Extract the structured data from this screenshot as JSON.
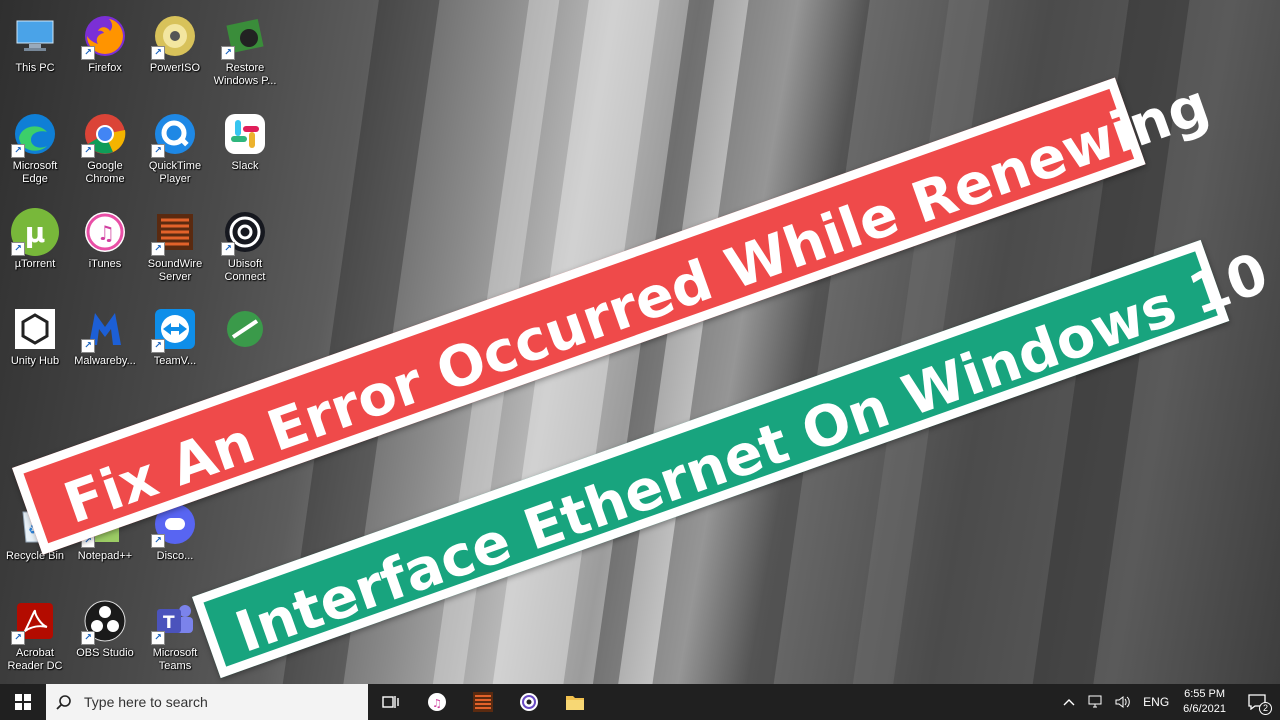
{
  "desktop": {
    "icons": [
      {
        "label": "This PC"
      },
      {
        "label": "Firefox"
      },
      {
        "label": "PowerISO"
      },
      {
        "label": "Restore\nWindows P..."
      },
      {
        "label": "Microsoft\nEdge"
      },
      {
        "label": "Google\nChrome"
      },
      {
        "label": "QuickTime\nPlayer"
      },
      {
        "label": "Slack"
      },
      {
        "label": "µTorrent"
      },
      {
        "label": "iTunes"
      },
      {
        "label": "SoundWire\nServer"
      },
      {
        "label": "Ubisoft\nConnect"
      },
      {
        "label": "Unity Hub"
      },
      {
        "label": "Malwareby..."
      },
      {
        "label": "TeamV..."
      },
      {
        "label": ""
      },
      {
        "label": "Recycle Bin"
      },
      {
        "label": "Notepad++"
      },
      {
        "label": "Disco..."
      },
      {
        "label": "Acrobat\nReader DC"
      },
      {
        "label": "OBS Studio"
      },
      {
        "label": "Microsoft\nTeams"
      }
    ]
  },
  "banners": {
    "line1": "Fix An Error Occurred While Renewing",
    "line2": "Interface Ethernet On Windows 10",
    "colors": {
      "red": "#ef4a4a",
      "green": "#18a47e"
    }
  },
  "taskbar": {
    "search_placeholder": "Type here to search",
    "pinned": [
      "task-view-icon",
      "itunes-icon",
      "soundwire-icon",
      "obs-icon",
      "file-explorer-icon"
    ],
    "tray": {
      "language": "ENG",
      "time": "6:55 PM",
      "date": "6/6/2021",
      "notification_count": "2"
    }
  }
}
